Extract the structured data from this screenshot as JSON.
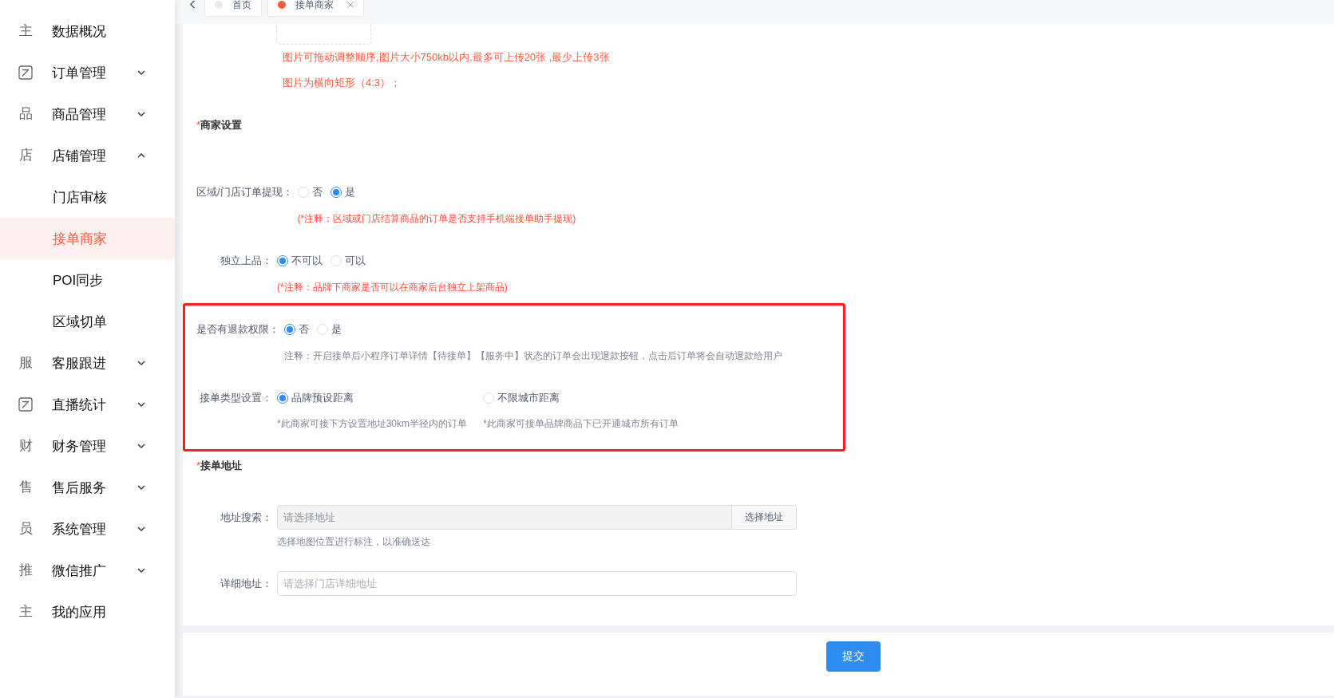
{
  "tab_bar": {
    "tabs": [
      {
        "label": "首页",
        "selected": false,
        "closable": false
      },
      {
        "label": "接单商家",
        "selected": true,
        "closable": true
      }
    ]
  },
  "sidebar": {
    "items": [
      {
        "label": "数据概况",
        "kind": "glyph",
        "icon_glyph": "主",
        "selected": false
      },
      {
        "label": "订单管理",
        "kind": "square",
        "selected": false,
        "expanded": false
      },
      {
        "label": "商品管理",
        "kind": "glyph",
        "icon_glyph": "品",
        "selected": false,
        "expanded": false
      },
      {
        "label": "店铺管理",
        "kind": "glyph",
        "icon_glyph": "店",
        "selected": false,
        "expanded": true,
        "children": [
          {
            "label": "门店审核",
            "selected": false
          },
          {
            "label": "接单商家",
            "selected": true
          },
          {
            "label": "POI同步",
            "selected": false
          },
          {
            "label": "区域切单",
            "selected": false
          }
        ]
      },
      {
        "label": "客服跟进",
        "kind": "glyph",
        "icon_glyph": "服",
        "selected": false,
        "expanded": false
      },
      {
        "label": "直播统计",
        "kind": "square",
        "selected": false,
        "expanded": false
      },
      {
        "label": "财务管理",
        "kind": "glyph",
        "icon_glyph": "财",
        "selected": false,
        "expanded": false
      },
      {
        "label": "售后服务",
        "kind": "glyph",
        "icon_glyph": "售",
        "selected": false,
        "expanded": false
      },
      {
        "label": "系统管理",
        "kind": "glyph",
        "icon_glyph": "员",
        "selected": false,
        "expanded": false
      },
      {
        "label": "微信推广",
        "kind": "glyph",
        "icon_glyph": "推",
        "selected": false,
        "expanded": false
      },
      {
        "label": "我的应用",
        "kind": "glyph",
        "icon_glyph": "主",
        "selected": false
      }
    ]
  },
  "upload": {
    "hints": [
      "图片可拖动调整顺序,图片大小750kb以内,最多可上传20张 ,最少上传3张",
      "图片为横向矩形（4:3）；"
    ]
  },
  "merchant_settings": {
    "marker": "*",
    "title": "商家设置",
    "groups": [
      {
        "highlighted": false,
        "fields": [
          {
            "kind": "inline",
            "label": "区域/门店订单提现：",
            "options": [
              {
                "label": "否",
                "selected": false
              },
              {
                "label": "是",
                "selected": true
              }
            ],
            "note": {
              "kind": "warning",
              "text": "(*注释：区域或门店结算商品的订单是否支持手机端接单助手提现)"
            }
          },
          {
            "kind": "inline",
            "label": "独立上品：",
            "options": [
              {
                "label": "不可以",
                "selected": true
              },
              {
                "label": "可以",
                "selected": false
              }
            ],
            "note": {
              "kind": "warning",
              "text": "(*注释：品牌下商家是否可以在商家后台独立上架商品)"
            }
          }
        ]
      },
      {
        "highlighted": true,
        "fields": [
          {
            "kind": "inline",
            "label": "是否有退款权限：",
            "options": [
              {
                "label": "否",
                "selected": true
              },
              {
                "label": "是",
                "selected": false
              }
            ],
            "note": {
              "kind": "muted",
              "text": "注释：开启接单后小程序订单详情【待接单】【服务中】状态的订单会出现退款按钮，点击后订单将会自动退款给用户"
            }
          },
          {
            "kind": "columns",
            "label": "接单类型设置：",
            "options": [
              {
                "label": "品牌预设距离",
                "selected": true,
                "note": "*此商家可接下方设置地址30km半径内的订单"
              },
              {
                "label": "不限城市距离",
                "selected": false,
                "note": "*此商家可接单品牌商品下已开通城市所有订单"
              }
            ]
          }
        ]
      }
    ]
  },
  "address": {
    "marker": "*",
    "title": "接单地址",
    "fields": [
      {
        "kind": "search",
        "label": "地址搜索：",
        "placeholder": "请选择地址",
        "disabled": true,
        "button": "选择地址",
        "hint": "选择地图位置进行标注，以准确送达"
      },
      {
        "kind": "text",
        "label": "详细地址：",
        "placeholder": "请选择门店详细地址",
        "disabled": false
      }
    ]
  },
  "submit_button": "提交"
}
